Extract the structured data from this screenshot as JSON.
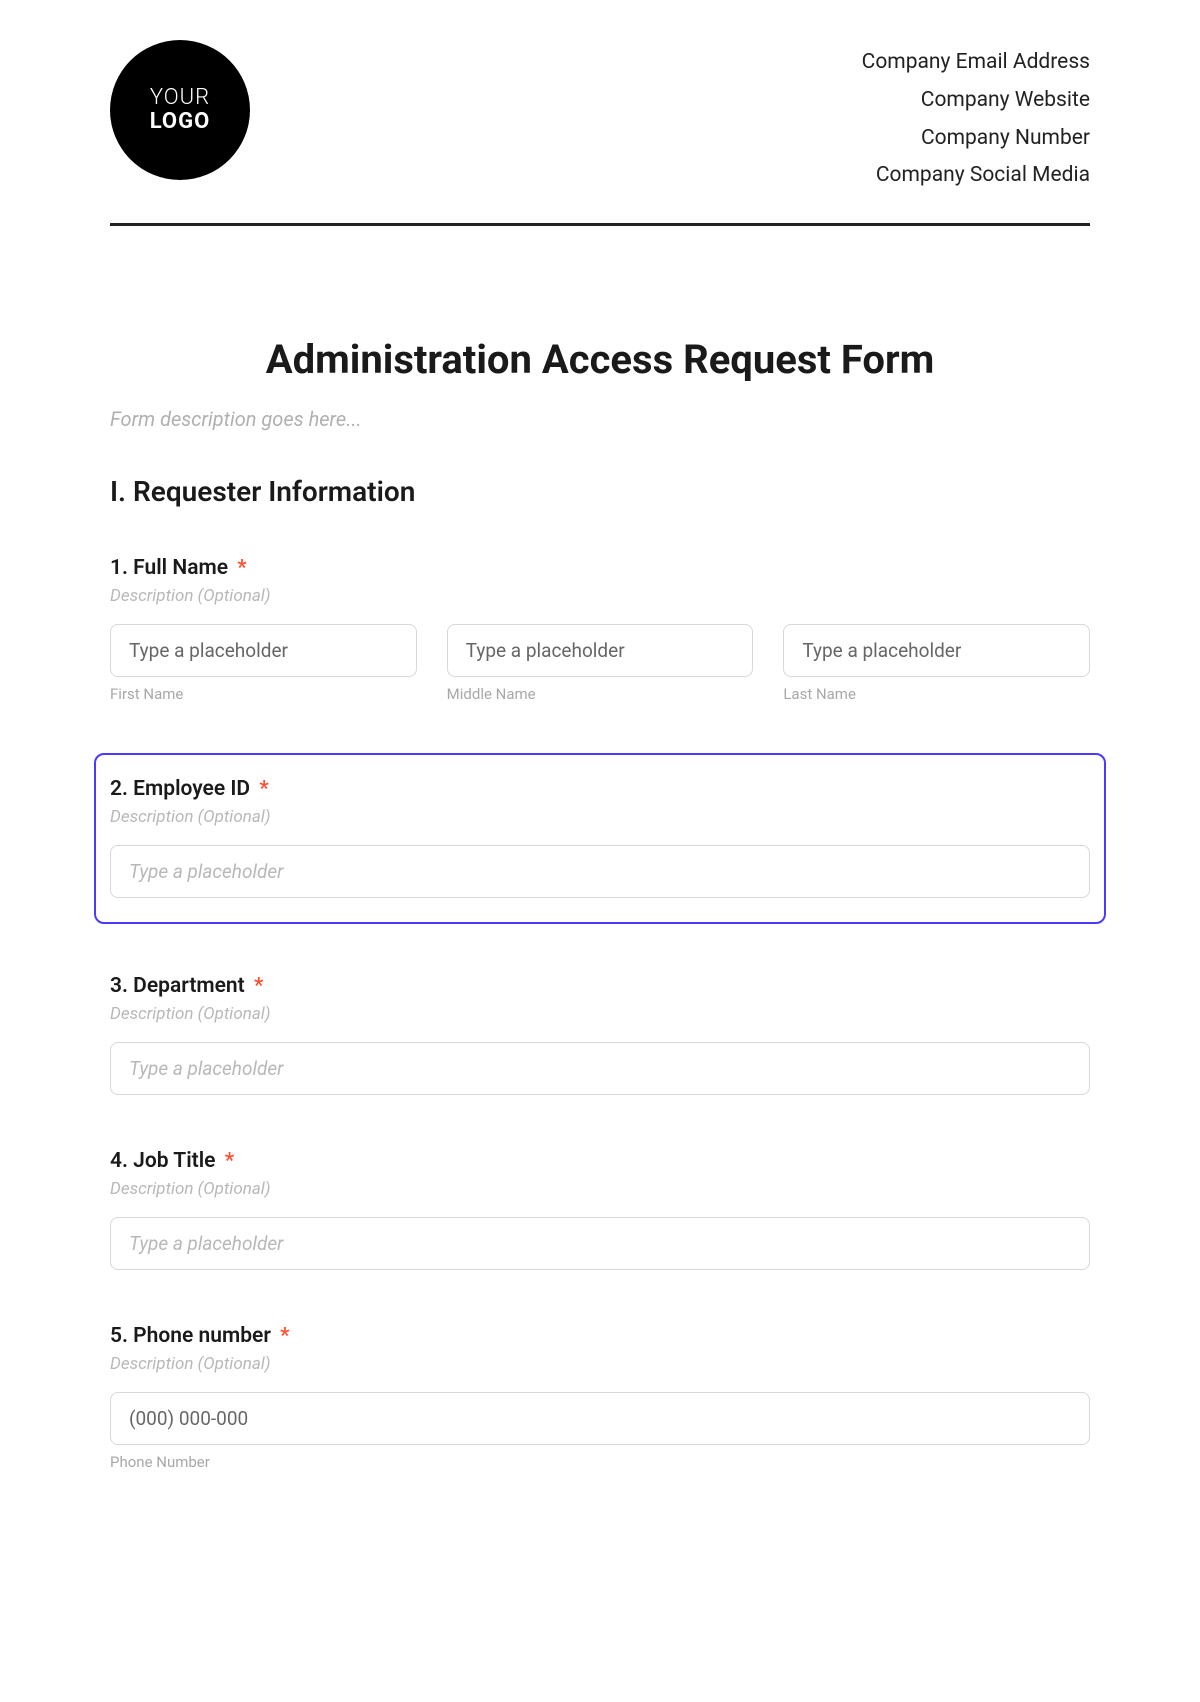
{
  "header": {
    "logo_line1": "YOUR",
    "logo_line2": "LOGO",
    "company_lines": [
      "Company Email Address",
      "Company Website",
      "Company Number",
      "Company Social Media"
    ]
  },
  "form": {
    "title": "Administration Access Request Form",
    "description_placeholder": "Form description goes here...",
    "section_heading": "I. Requester Information",
    "questions": {
      "q1": {
        "label": "1. Full Name",
        "required_mark": "*",
        "desc": "Description (Optional)",
        "fields": [
          {
            "placeholder": "Type a placeholder",
            "sublabel": "First Name"
          },
          {
            "placeholder": "Type a placeholder",
            "sublabel": "Middle Name"
          },
          {
            "placeholder": "Type a placeholder",
            "sublabel": "Last Name"
          }
        ]
      },
      "q2": {
        "label": "2. Employee ID",
        "required_mark": "*",
        "desc": "Description (Optional)",
        "placeholder": "Type a placeholder"
      },
      "q3": {
        "label": "3. Department",
        "required_mark": "*",
        "desc": "Description (Optional)",
        "placeholder": "Type a placeholder"
      },
      "q4": {
        "label": "4. Job Title",
        "required_mark": "*",
        "desc": "Description (Optional)",
        "placeholder": "Type a placeholder"
      },
      "q5": {
        "label": "5. Phone number",
        "required_mark": "*",
        "desc": "Description (Optional)",
        "placeholder": "(000) 000-000",
        "sublabel": "Phone Number"
      }
    }
  }
}
